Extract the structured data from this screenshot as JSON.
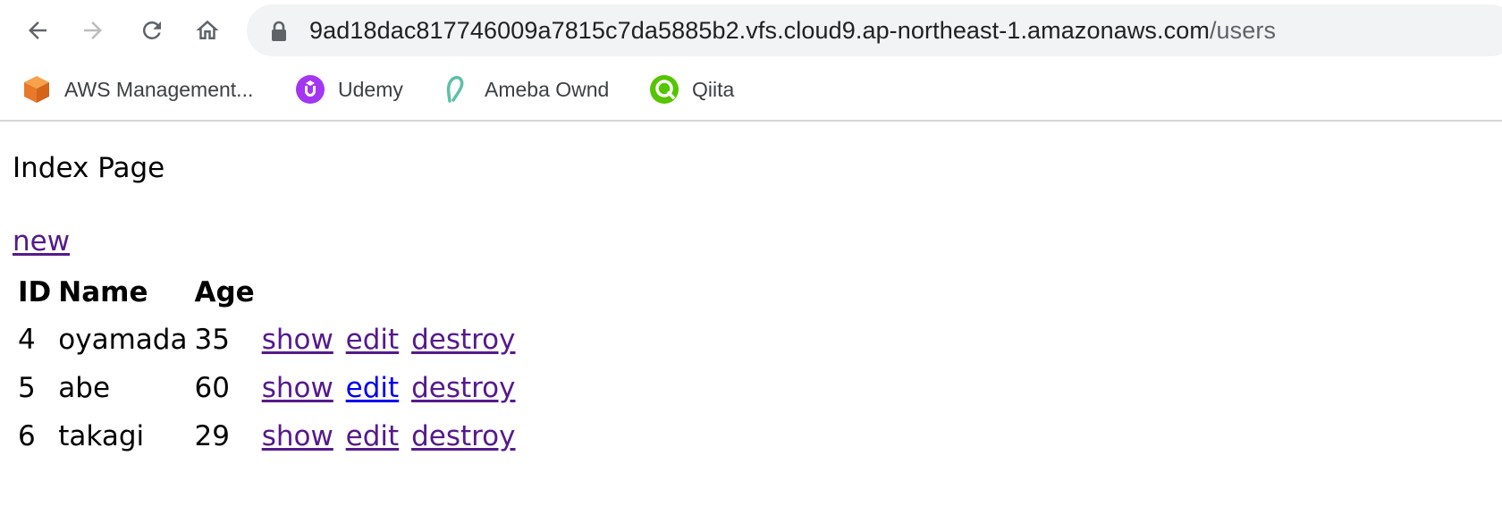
{
  "browser": {
    "url_host": "9ad18dac817746009a7815c7da5885b2.vfs.cloud9.ap-northeast-1.amazonaws.com",
    "url_path": "/users"
  },
  "bookmarks": [
    {
      "label": "AWS Management...",
      "icon": "aws-cube-icon",
      "color": "#e8792b"
    },
    {
      "label": "Udemy",
      "icon": "udemy-icon",
      "color": "#a435f0"
    },
    {
      "label": "Ameba Ownd",
      "icon": "ameba-ownd-icon",
      "color": "#5fbfa8"
    },
    {
      "label": "Qiita",
      "icon": "qiita-icon",
      "color": "#55c500"
    }
  ],
  "page": {
    "title": "Index Page",
    "new_link": "new",
    "table": {
      "headers": [
        "ID",
        "Name",
        "Age"
      ],
      "rows": [
        {
          "id": "4",
          "name": "oyamada",
          "age": "35",
          "show": "show",
          "edit": "edit",
          "destroy": "destroy"
        },
        {
          "id": "5",
          "name": "abe",
          "age": "60",
          "show": "show",
          "edit": "edit",
          "destroy": "destroy"
        },
        {
          "id": "6",
          "name": "takagi",
          "age": "29",
          "show": "show",
          "edit": "edit",
          "destroy": "destroy"
        }
      ]
    }
  },
  "colors": {
    "visited_link": "#551a8b",
    "unvisited_link": "#0000ee",
    "omnibox_bg": "#f1f3f4"
  }
}
